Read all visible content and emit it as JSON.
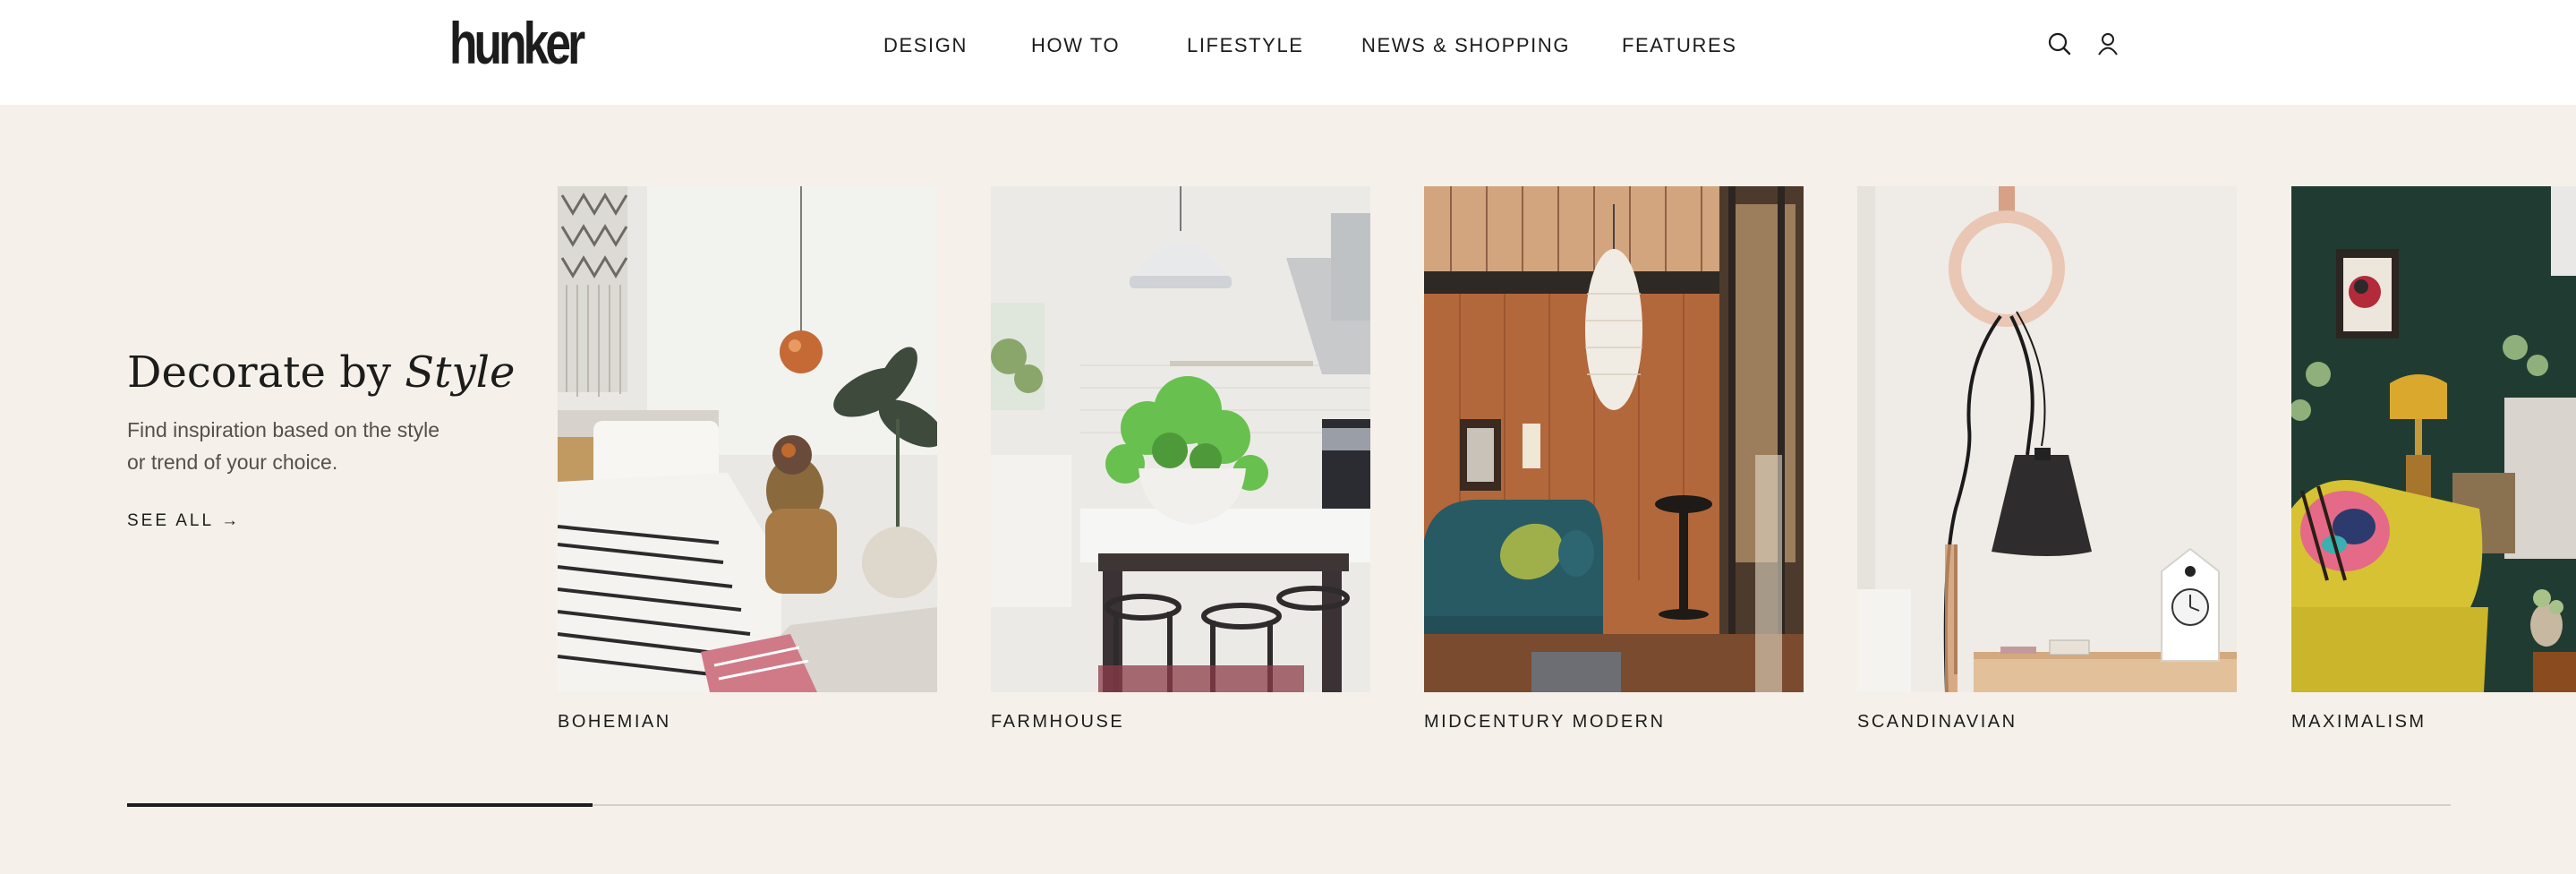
{
  "header": {
    "logo": "hunker",
    "logo_tm": "™",
    "nav": [
      {
        "label": "DESIGN"
      },
      {
        "label": "HOW TO"
      },
      {
        "label": "LIFESTYLE"
      },
      {
        "label": "NEWS & SHOPPING"
      },
      {
        "label": "FEATURES"
      }
    ],
    "icons": [
      "search-icon",
      "user-icon"
    ]
  },
  "intro": {
    "title_plain": "Decorate by ",
    "title_italic": "Style",
    "description": "Find inspiration based on the style or trend of your choice.",
    "see_all": "SEE ALL",
    "arrow": "→"
  },
  "cards": [
    {
      "label": "BOHEMIAN"
    },
    {
      "label": "FARMHOUSE"
    },
    {
      "label": "MIDCENTURY MODERN"
    },
    {
      "label": "SCANDINAVIAN"
    },
    {
      "label": "MAXIMALISM"
    }
  ],
  "colors": {
    "background": "#f5f0e9",
    "header": "#ffffff",
    "text": "#1c1c1c"
  }
}
